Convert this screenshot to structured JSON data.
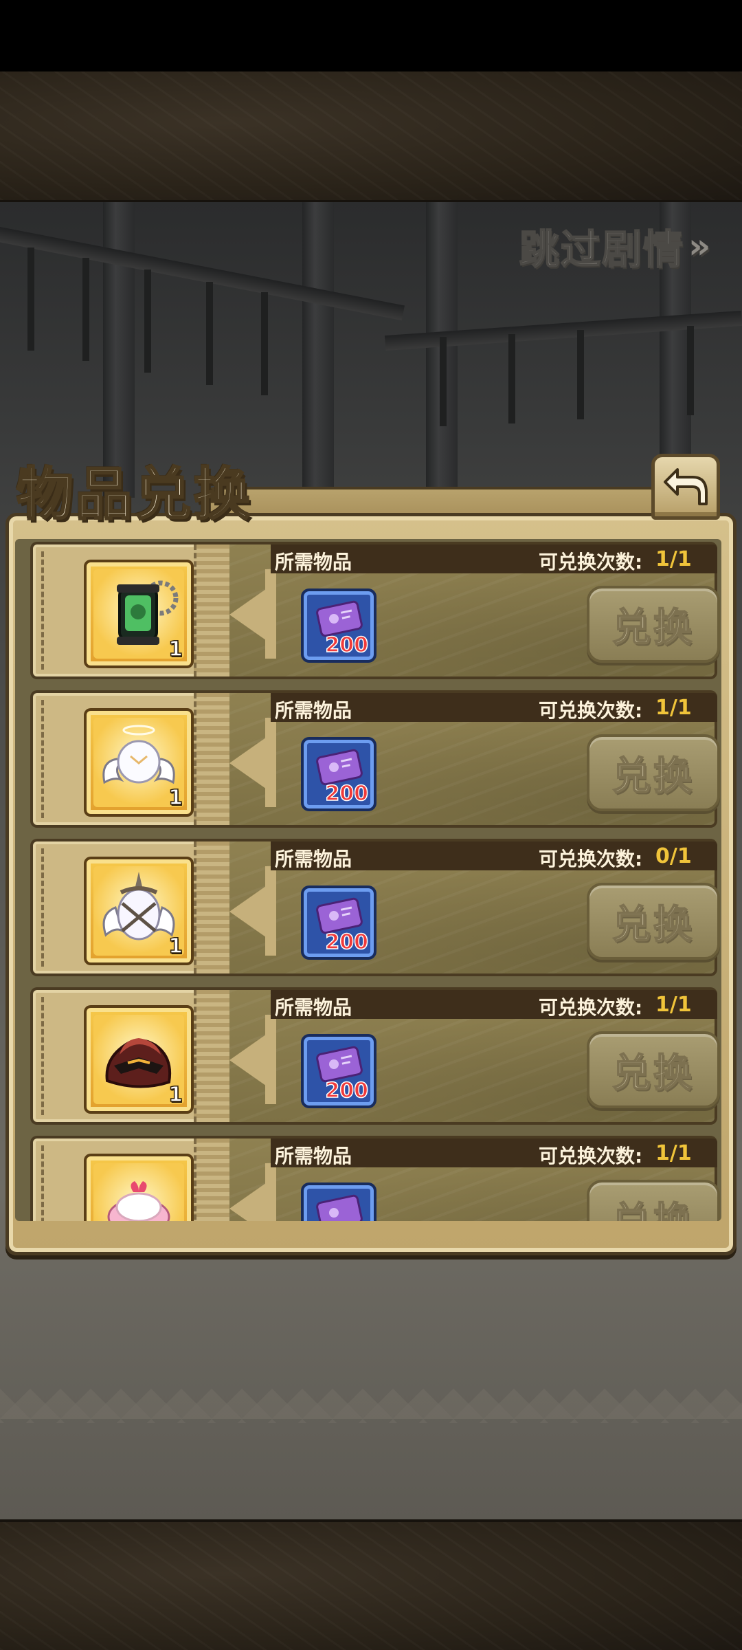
{
  "skip_story": {
    "label": "跳过剧情",
    "arrows": "»"
  },
  "panel": {
    "title": "物品兑换"
  },
  "icons": {
    "back": "back-arrow-icon",
    "cost": "purple-ticket-icon"
  },
  "colors": {
    "times_value": "#f0c43a",
    "cost_value": "#f03a3a",
    "frame_gold": "#f6c84a",
    "cost_blue": "#2e53a8"
  },
  "rows": [
    {
      "required_label": "所需物品",
      "times_label": "可兑换次数:",
      "times_value": "1/1",
      "item_icon": "green-lantern-icon",
      "item_count": "1",
      "cost_value": "200",
      "button_label": "兑换"
    },
    {
      "required_label": "所需物品",
      "times_label": "可兑换次数:",
      "times_value": "1/1",
      "item_icon": "angel-wings-orb-icon",
      "item_count": "1",
      "cost_value": "200",
      "button_label": "兑换"
    },
    {
      "required_label": "所需物品",
      "times_label": "可兑换次数:",
      "times_value": "0/1",
      "item_icon": "spiked-wing-egg-icon",
      "item_count": "1",
      "cost_value": "200",
      "button_label": "兑换"
    },
    {
      "required_label": "所需物品",
      "times_label": "可兑换次数:",
      "times_value": "1/1",
      "item_icon": "red-hood-cloak-icon",
      "item_count": "1",
      "cost_value": "200",
      "button_label": "兑换"
    },
    {
      "required_label": "所需物品",
      "times_label": "可兑换次数:",
      "times_value": "1/1",
      "item_icon": "pink-cake-icon",
      "item_count": "",
      "cost_value": "",
      "button_label": "兑换"
    }
  ]
}
